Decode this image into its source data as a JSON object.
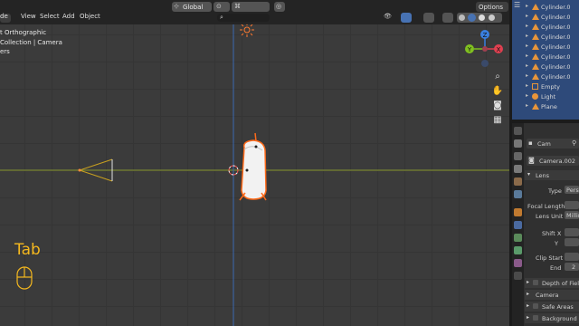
{
  "header": {
    "menus": [
      "de",
      "View",
      "Select",
      "Add",
      "Object"
    ],
    "orientation": "Global",
    "options_label": "Options"
  },
  "overlay": {
    "view_name": "t Orthographic",
    "collection": "Collection | Camera",
    "units": "ers"
  },
  "gizmo": {
    "x": "X",
    "y": "Y",
    "z": "Z"
  },
  "key_hint": {
    "label": "Tab"
  },
  "outliner": {
    "items": [
      {
        "label": "Cylinder.0",
        "icon": "triangle-icon",
        "color": "#e8953a"
      },
      {
        "label": "Cylinder.0",
        "icon": "triangle-icon",
        "color": "#e8953a"
      },
      {
        "label": "Cylinder.0",
        "icon": "triangle-icon",
        "color": "#e8953a"
      },
      {
        "label": "Cylinder.0",
        "icon": "triangle-icon",
        "color": "#e8953a"
      },
      {
        "label": "Cylinder.0",
        "icon": "triangle-icon",
        "color": "#e8953a"
      },
      {
        "label": "Cylinder.0",
        "icon": "triangle-icon",
        "color": "#e8953a"
      },
      {
        "label": "Cylinder.0",
        "icon": "triangle-icon",
        "color": "#e8953a"
      },
      {
        "label": "Cylinder.0",
        "icon": "triangle-icon",
        "color": "#e8953a"
      },
      {
        "label": "Empty",
        "icon": "empty-icon",
        "color": "#e8953a"
      },
      {
        "label": "Light",
        "icon": "light-icon",
        "color": "#e8953a"
      },
      {
        "label": "Plane",
        "icon": "triangle-icon",
        "color": "#e8953a"
      }
    ]
  },
  "properties": {
    "object_name": "Cam",
    "data_name": "Camera.002",
    "lens_panel": "Lens",
    "type_label": "Type",
    "type_value": "Persp",
    "focal_length_label": "Focal Length",
    "lens_unit_label": "Lens Unit",
    "lens_unit_value": "Millim",
    "shift_x_label": "Shift X",
    "shift_y_label": "Y",
    "clip_start_label": "Clip Start",
    "clip_end_label": "End",
    "clip_end_value": "2",
    "panels": [
      "Depth of Field",
      "Camera",
      "Safe Areas",
      "Background Im"
    ]
  },
  "colors": {
    "accent": "#4772b3",
    "selection_orange": "#ff8a3d",
    "axis_x": "#e04050",
    "axis_y": "#80c020",
    "axis_z": "#3a80e0",
    "key_hint": "#f5b81e"
  }
}
